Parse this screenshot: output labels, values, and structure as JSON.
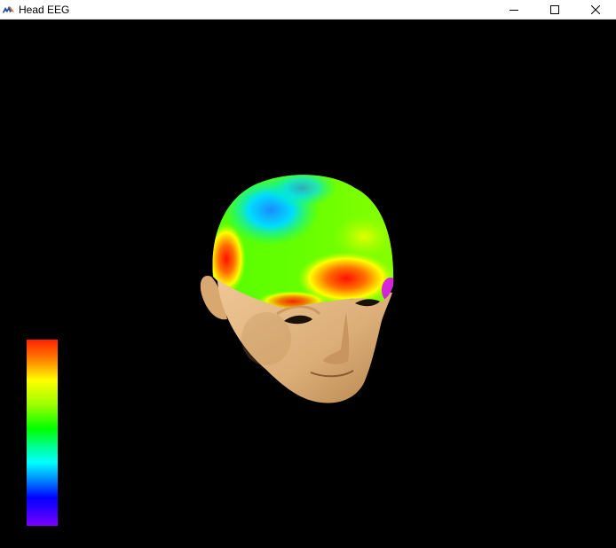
{
  "window": {
    "title": "Head EEG",
    "app_icon": "matlab-icon",
    "controls": {
      "minimize_icon": "minimize-icon",
      "maximize_icon": "maximize-icon",
      "close_icon": "close-icon"
    }
  },
  "viewport": {
    "background": "#000000",
    "colormap": [
      "#7a00ff",
      "#0000ff",
      "#00ffff",
      "#00ff00",
      "#ffff00",
      "#ff7a00",
      "#ff2000"
    ],
    "skin_color": "#e0b07a"
  }
}
